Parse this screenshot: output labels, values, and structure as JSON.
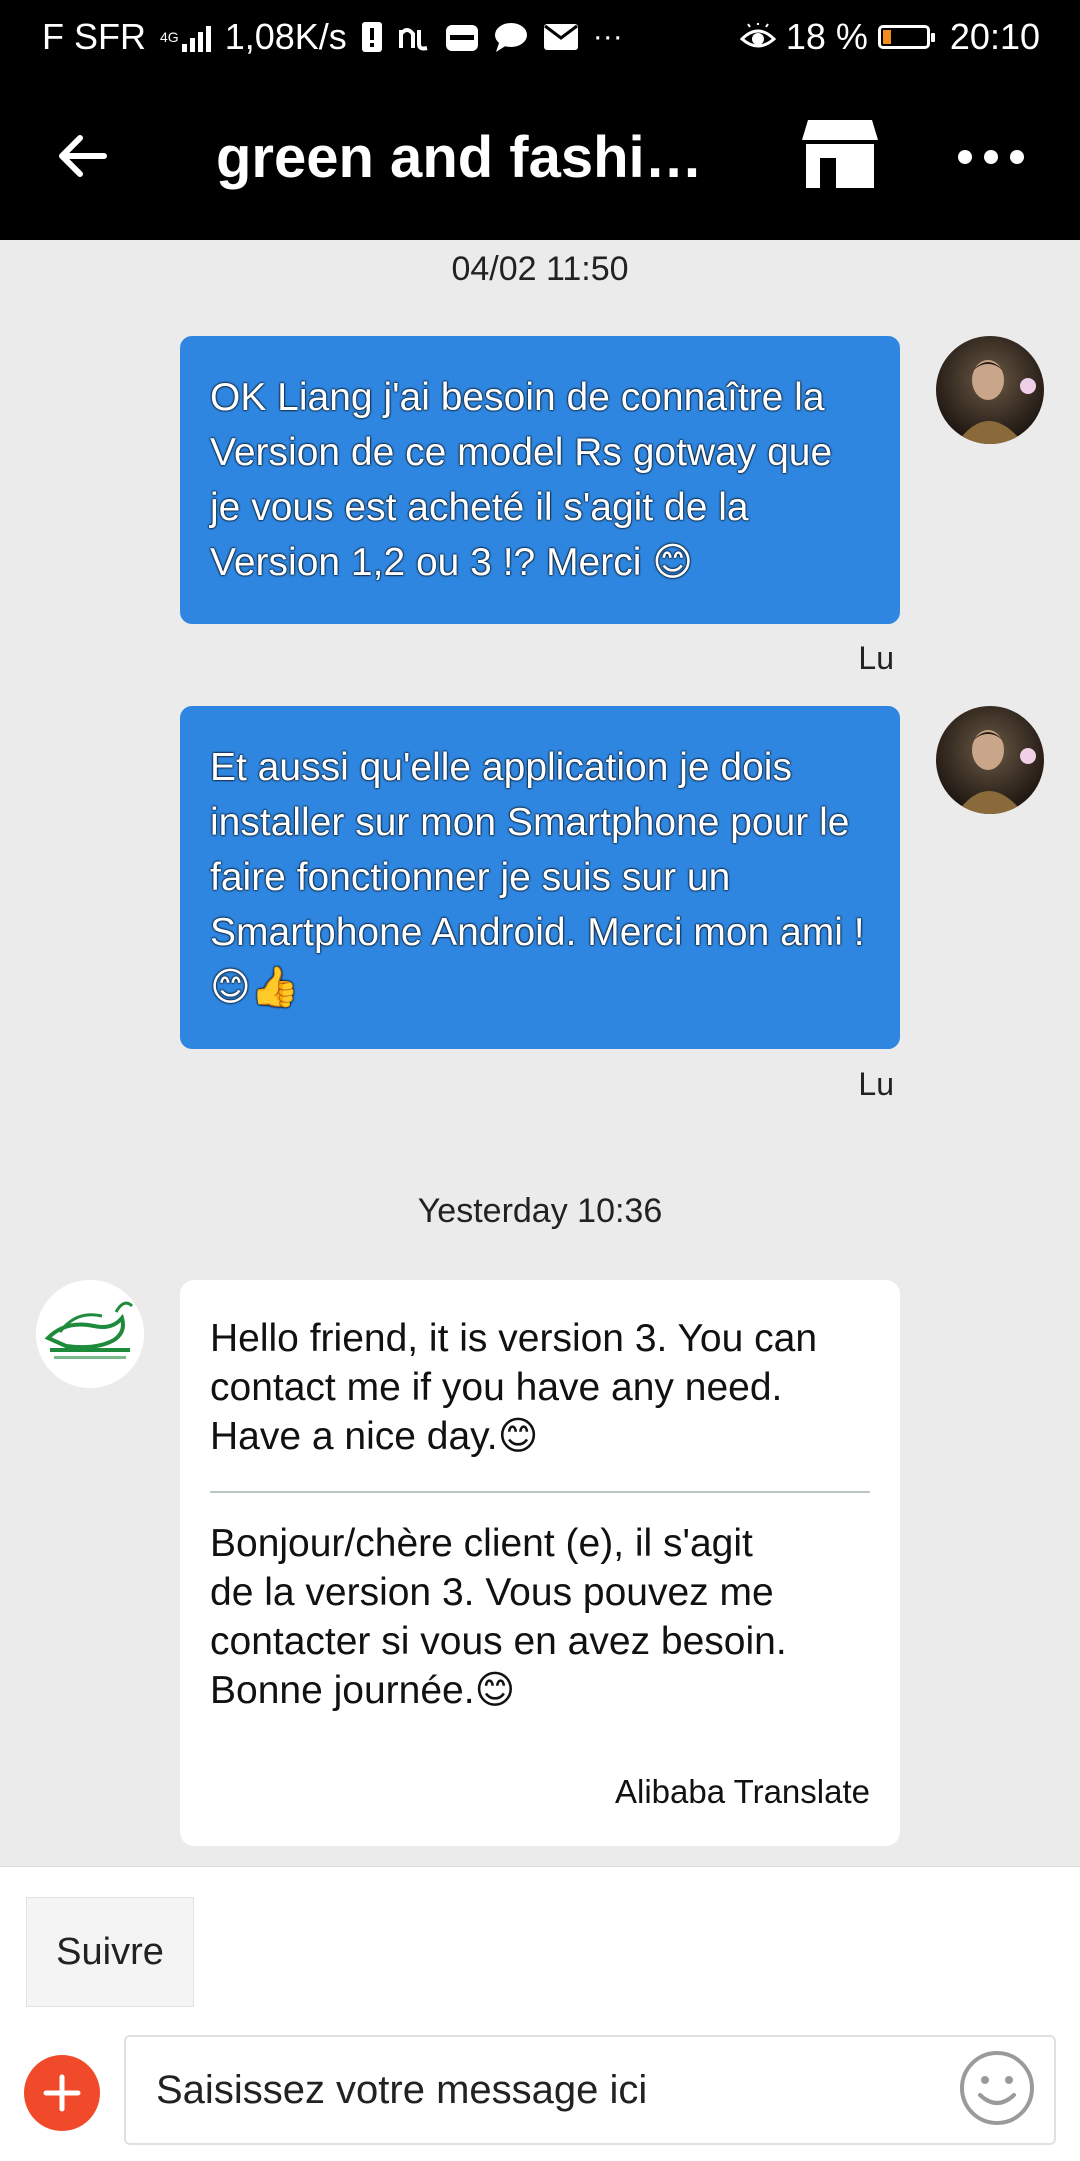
{
  "status_bar": {
    "carrier": "F SFR",
    "network": "4G",
    "speed": "1,08K/s",
    "battery": "18 %",
    "battery_level": 0.18,
    "time": "20:10"
  },
  "header": {
    "title": "green and fashio…",
    "back_icon": "arrow-left-icon",
    "store_icon": "store-icon",
    "more_icon": "more-dots-icon"
  },
  "messages": [
    {
      "type": "timestamp",
      "text": "04/02 11:50"
    },
    {
      "type": "outgoing",
      "text": "OK Liang j'ai besoin de connaître la Version de ce model Rs gotway que je vous est acheté il s'agit de la Version 1,2 ou 3 !? Merci 😊",
      "sender": "Lu"
    },
    {
      "type": "outgoing",
      "text": "Et aussi  qu'elle application je dois installer sur mon Smartphone pour le faire fonctionner je suis sur un Smartphone Android. Merci mon ami ! 😊👍",
      "sender": "Lu"
    },
    {
      "type": "timestamp",
      "text": "Yesterday 10:36"
    },
    {
      "type": "incoming",
      "text": "Hello friend, it is version 3. You can contact me if you have any need. Have a nice day.😊",
      "translation": "Bonjour/chère client (e), il s'agit de la version 3. Vous pouvez me contacter si vous en avez besoin. Bonne journée.😊",
      "translation_credit": "Alibaba Translate"
    }
  ],
  "bottom": {
    "follow_label": "Suivre",
    "input_placeholder": "Saisissez votre message ici"
  },
  "colors": {
    "outgoing_bubble": "#2e86e0",
    "header_bg": "#000000",
    "plus_button": "#f04a2a"
  }
}
